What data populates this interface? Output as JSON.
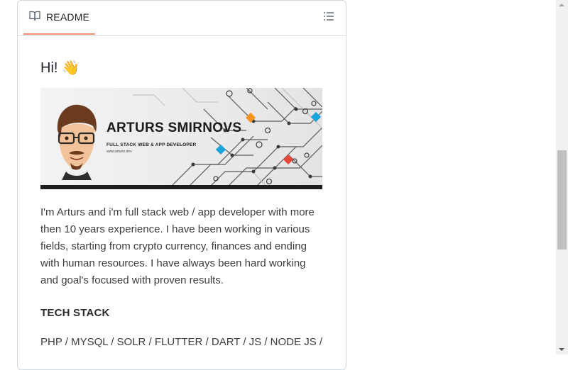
{
  "readme": {
    "tab_label": "README",
    "greeting": "Hi! 👋",
    "banner": {
      "name": "ARTURS SMIRNOVS",
      "role": "FULL STACK WEB & APP DEVELOPER",
      "url": "www.arturio.dev"
    },
    "bio": "I'm Arturs and i'm full stack web / app developer with more then 10 years experience. I have been working in various fields, starting from crypto currency, finances and ending with human resources. I have always been hard working and goal's focused with proven results.",
    "tech_stack_heading": "TECH STACK",
    "tech_stack": "PHP / MYSQL / SOLR / FLUTTER / DART / JS / NODE JS /"
  },
  "icons": {
    "tab": "book-icon",
    "outline": "list-unordered-icon"
  },
  "colors": {
    "tab_underline": "#fd8c73",
    "banner_accent_orange": "#f7941d",
    "banner_accent_blue": "#1aa3d9",
    "banner_accent_red": "#e8493b"
  }
}
